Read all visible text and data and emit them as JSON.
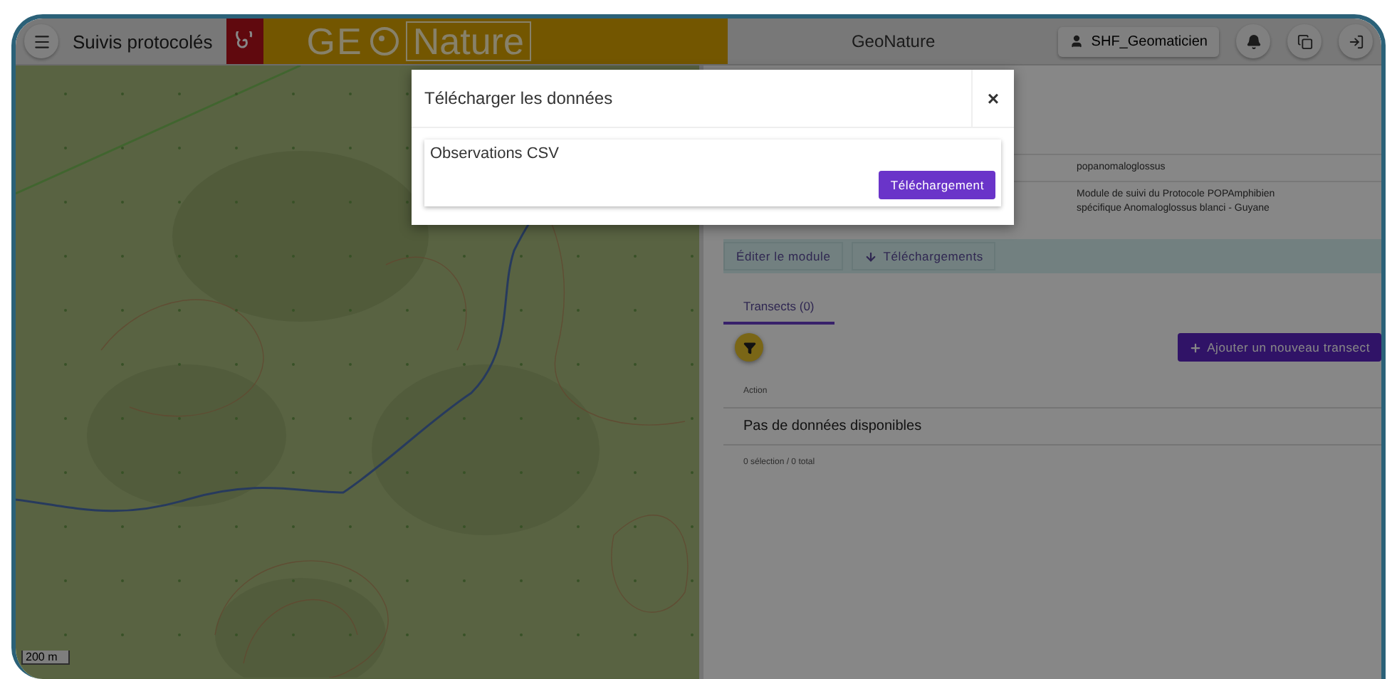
{
  "header": {
    "title": "Suivis protocolés",
    "logo": {
      "left": "GE",
      "right": "Nature"
    },
    "app_name": "GeoNature",
    "user": "SHF_Geomaticien"
  },
  "map": {
    "scale": "200 m"
  },
  "details": [
    {
      "value": "popanomaloglossus"
    },
    {
      "value": "Module de suivi du Protocole POPAmphibien spécifique Anomaloglossus blanci - Guyane"
    }
  ],
  "actions": [
    {
      "label": "Éditer le module",
      "kind": "plain"
    },
    {
      "label": "Téléchargements",
      "kind": "download"
    }
  ],
  "tabs": [
    {
      "label": "Transects (0)",
      "selected": true
    }
  ],
  "add_button": "Ajouter un nouveau transect",
  "table": {
    "columns": [
      "Action"
    ],
    "empty": "Pas de données disponibles",
    "footer": "0 sélection / 0 total"
  },
  "modal": {
    "title": "Télécharger les données",
    "close": "×",
    "items": [
      {
        "label": "Observations CSV",
        "button": "Téléchargement"
      }
    ]
  }
}
